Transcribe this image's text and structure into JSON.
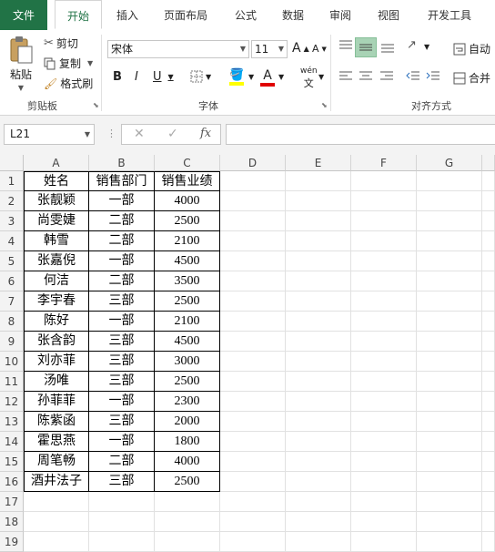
{
  "tabs": [
    "文件",
    "开始",
    "插入",
    "页面布局",
    "公式",
    "数据",
    "审阅",
    "视图",
    "开发工具"
  ],
  "active_tab": "开始",
  "ribbon": {
    "clipboard": {
      "paste": "粘贴",
      "cut": "剪切",
      "copy": "复制",
      "format_painter": "格式刷",
      "label": "剪贴板"
    },
    "font": {
      "name": "宋体",
      "size": "11",
      "bold": "B",
      "italic": "I",
      "underline": "U",
      "grow": "A",
      "shrink": "A",
      "phonetic": "wén",
      "label": "字体"
    },
    "alignment": {
      "wrap": "自动",
      "merge": "合并",
      "label": "对齐方式"
    }
  },
  "formula_bar": {
    "name_box": "L21",
    "fx": "fx",
    "formula": ""
  },
  "columns": [
    "A",
    "B",
    "C",
    "D",
    "E",
    "F",
    "G"
  ],
  "rows": [
    "1",
    "2",
    "3",
    "4",
    "5",
    "6",
    "7",
    "8",
    "9",
    "10",
    "11",
    "12",
    "13",
    "14",
    "15",
    "16",
    "17",
    "18",
    "19"
  ],
  "table": {
    "headers": [
      "姓名",
      "销售部门",
      "销售业绩"
    ],
    "records": [
      [
        "张靓颖",
        "一部",
        "4000"
      ],
      [
        "尚雯婕",
        "二部",
        "2500"
      ],
      [
        "韩雪",
        "二部",
        "2100"
      ],
      [
        "张嘉倪",
        "一部",
        "4500"
      ],
      [
        "何洁",
        "二部",
        "3500"
      ],
      [
        "李宇春",
        "三部",
        "2500"
      ],
      [
        "陈好",
        "一部",
        "2100"
      ],
      [
        "张含韵",
        "三部",
        "4500"
      ],
      [
        "刘亦菲",
        "三部",
        "3000"
      ],
      [
        "汤唯",
        "三部",
        "2500"
      ],
      [
        "孙菲菲",
        "一部",
        "2300"
      ],
      [
        "陈紫函",
        "三部",
        "2000"
      ],
      [
        "霍思燕",
        "一部",
        "1800"
      ],
      [
        "周笔畅",
        "二部",
        "4000"
      ],
      [
        "酒井法子",
        "三部",
        "2500"
      ]
    ]
  },
  "colors": {
    "brand": "#217346",
    "header_bg": "#f3f3f3",
    "align_active": "#a8d3b5"
  }
}
